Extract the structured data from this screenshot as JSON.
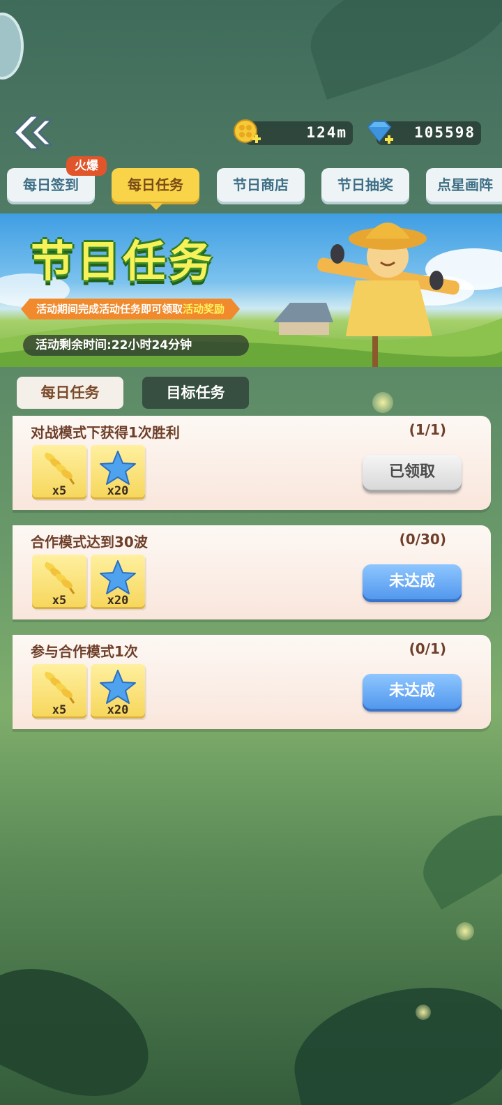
{
  "header": {
    "coin_amount": "124m",
    "gem_amount": "105598"
  },
  "tabs": [
    {
      "label": "每日签到",
      "badge": "火爆"
    },
    {
      "label": "每日任务",
      "active": true
    },
    {
      "label": "节日商店"
    },
    {
      "label": "节日抽奖"
    },
    {
      "label": "点星画阵"
    }
  ],
  "banner": {
    "title": "节日任务",
    "subtitle_prefix": "活动期间完成活动任务即可领取",
    "subtitle_highlight": "活动奖励",
    "timer": "活动剩余时间:22小时24分钟"
  },
  "subtabs": {
    "daily": "每日任务",
    "goal": "目标任务"
  },
  "tasks": [
    {
      "title": "对战模式下获得1次胜利",
      "progress": "(1/1)",
      "rewards": [
        {
          "icon": "wheat-icon",
          "qty": "x5"
        },
        {
          "icon": "blue-star-icon",
          "qty": "x20"
        }
      ],
      "button": "已领取",
      "state": "claimed"
    },
    {
      "title": "合作模式达到30波",
      "progress": "(0/30)",
      "rewards": [
        {
          "icon": "wheat-icon",
          "qty": "x5"
        },
        {
          "icon": "blue-star-icon",
          "qty": "x20"
        }
      ],
      "button": "未达成",
      "state": "pending"
    },
    {
      "title": "参与合作模式1次",
      "progress": "(0/1)",
      "rewards": [
        {
          "icon": "wheat-icon",
          "qty": "x5"
        },
        {
          "icon": "blue-star-icon",
          "qty": "x20"
        }
      ],
      "button": "未达成",
      "state": "pending"
    }
  ],
  "colors": {
    "active_tab": "#f9d449",
    "claimed_button": "#d6d6d6",
    "pending_button": "#4e94ec",
    "task_text": "#6f3f2a"
  }
}
